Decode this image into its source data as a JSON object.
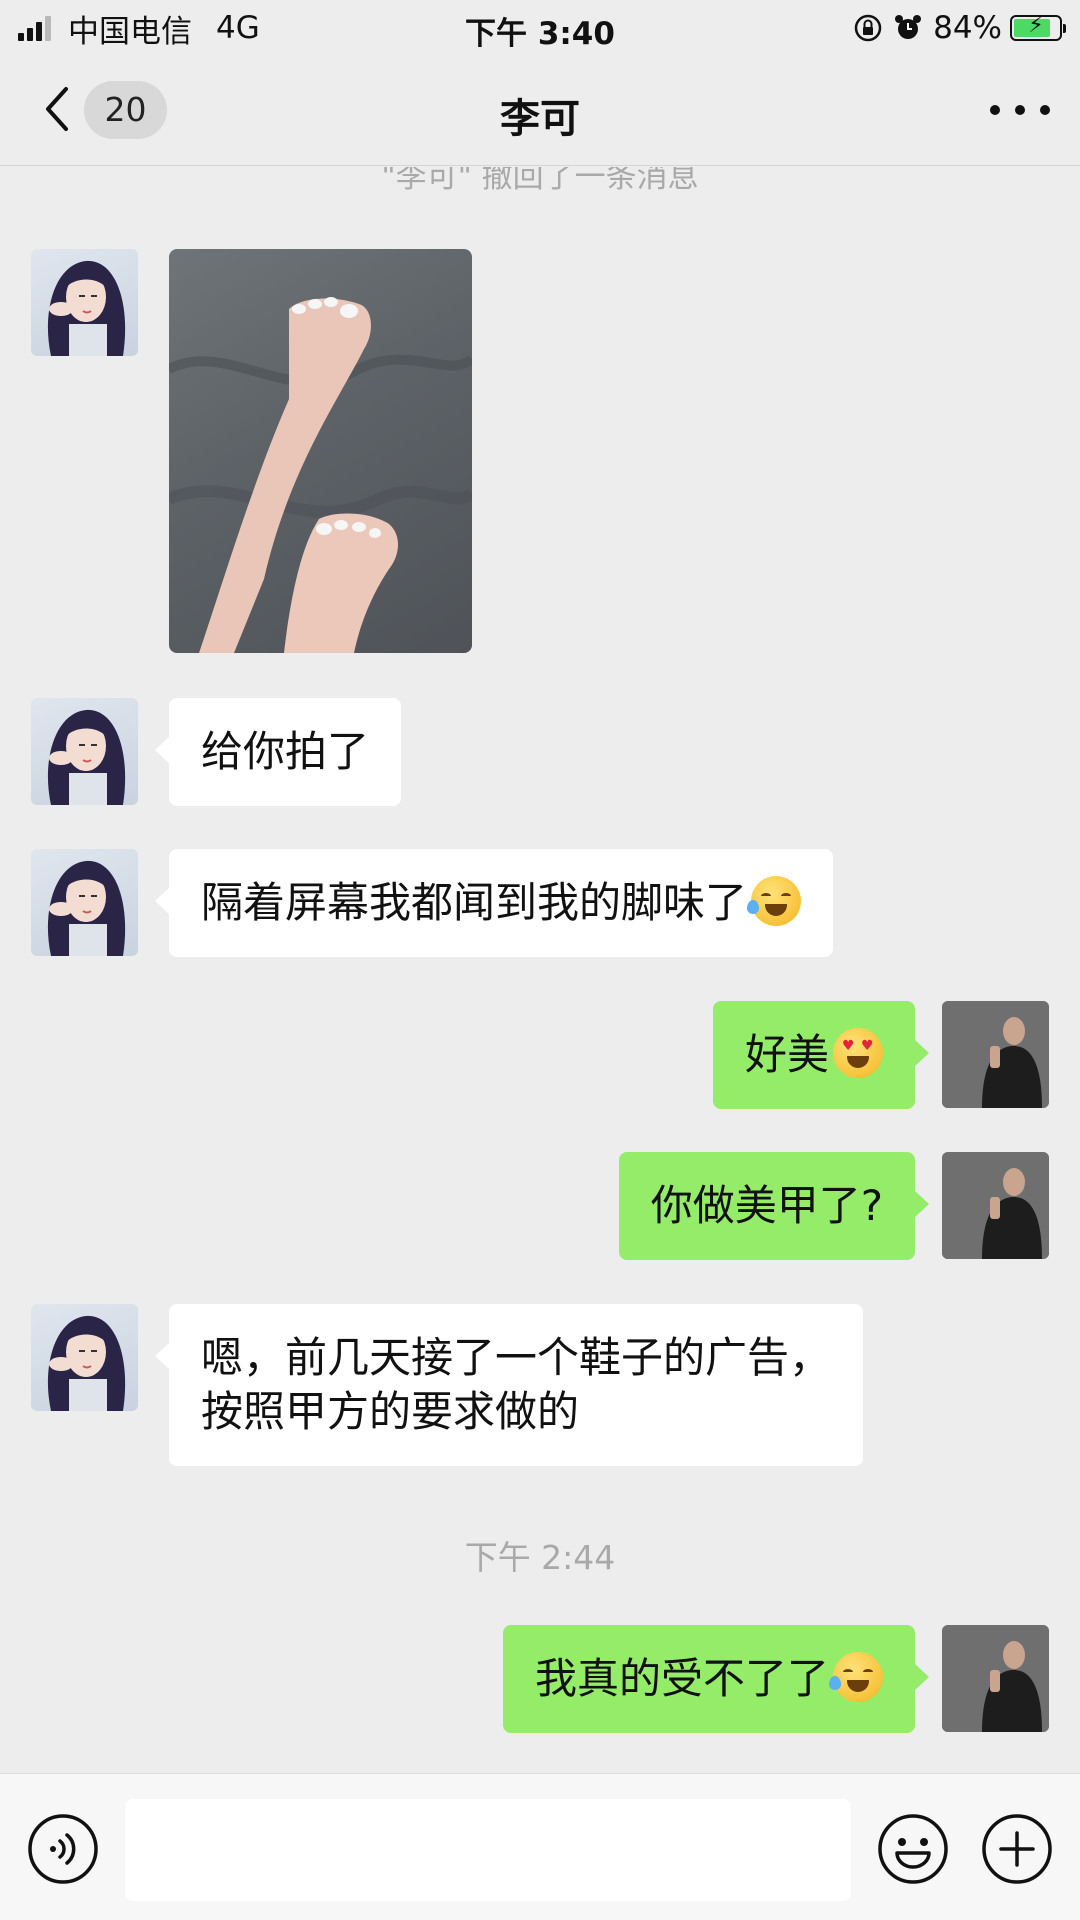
{
  "status_bar": {
    "carrier": "中国电信",
    "network": "4G",
    "time": "下午 3:40",
    "battery_text": "84%",
    "battery_level": 0.84
  },
  "nav": {
    "unread_count": "20",
    "title": "李可"
  },
  "chat": {
    "recall_notice": "\"李可\" 撤回了一条消息",
    "messages": [
      {
        "from": "them",
        "type": "image",
        "desc": "photo"
      },
      {
        "from": "them",
        "type": "text",
        "text": "给你拍了"
      },
      {
        "from": "them",
        "type": "text",
        "text": "隔着屏幕我都闻到我的脚味了",
        "emoji": "laughing-crying-emoji"
      },
      {
        "from": "me",
        "type": "text",
        "text": "好美",
        "emoji": "heart-eyes-emoji"
      },
      {
        "from": "me",
        "type": "text",
        "text": "你做美甲了?"
      },
      {
        "from": "them",
        "type": "text",
        "lines": [
          "嗯，前几天接了一个鞋子的广告，",
          "按照甲方的要求做的"
        ]
      },
      {
        "from": "me",
        "type": "text",
        "text": "我真的受不了了",
        "emoji": "laughing-crying-emoji"
      }
    ],
    "timestamp": "下午 2:44"
  },
  "input_bar": {
    "value": "",
    "placeholder": ""
  },
  "colors": {
    "background": "#ededed",
    "outgoing_bubble": "#95ec69",
    "incoming_bubble": "#ffffff",
    "battery_fill": "#4cd964"
  }
}
